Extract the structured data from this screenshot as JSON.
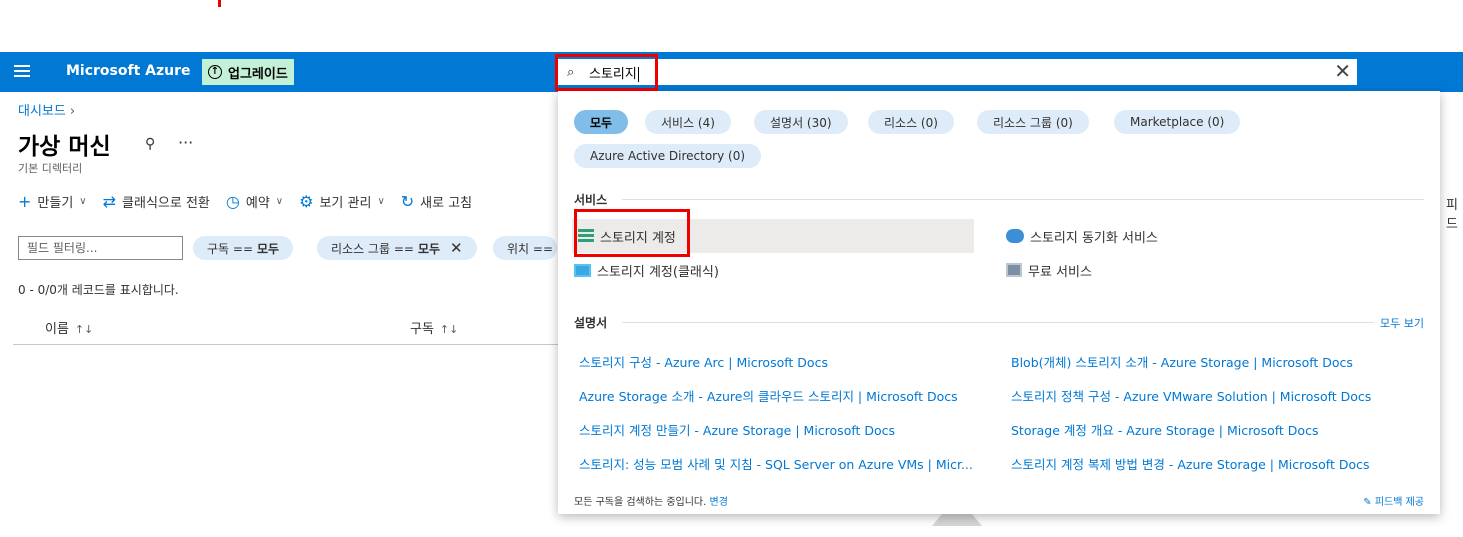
{
  "topbar": {
    "brand": "Microsoft Azure",
    "upgrade_label": "업그레이드",
    "search_value": "스토리지"
  },
  "page": {
    "breadcrumb": "대시보드",
    "title": "가상 머신",
    "subtitle": "기본 디렉터리",
    "commands": [
      {
        "icon": "plus-icon",
        "label": "만들기"
      },
      {
        "icon": "switch-icon",
        "label": "클래식으로 전환"
      },
      {
        "icon": "clock-icon",
        "label": "예약"
      },
      {
        "icon": "gear-icon",
        "label": "보기 관리"
      },
      {
        "icon": "refresh-icon",
        "label": "새로 고침"
      }
    ],
    "feedback_partial": "피드",
    "filter_placeholder": "필드 필터링...",
    "filter_pills": [
      {
        "key": "구독 ==",
        "value": "모두"
      },
      {
        "key": "리소스 그룹 ==",
        "value": "모두"
      },
      {
        "key": "위치 ==",
        "value": ""
      }
    ],
    "records": "0 - 0/0개 레코드를 표시합니다.",
    "columns": [
      "이름",
      "구독"
    ]
  },
  "dropdown": {
    "chips": [
      {
        "label": "모두",
        "active": true
      },
      {
        "label": "서비스  (4)"
      },
      {
        "label": "설명서  (30)"
      },
      {
        "label": "리소스  (0)"
      },
      {
        "label": "리소스 그룹  (0)"
      },
      {
        "label": "Marketplace  (0)"
      },
      {
        "label": "Azure Active Directory  (0)"
      }
    ],
    "services_title": "서비스",
    "services": [
      {
        "icon": "storage-account-icon",
        "label": "스토리지 계정"
      },
      {
        "icon": "storage-sync-icon",
        "label": "스토리지 동기화 서비스"
      },
      {
        "icon": "storage-classic-icon",
        "label": "스토리지 계정(클래식)"
      },
      {
        "icon": "free-services-icon",
        "label": "무료 서비스"
      }
    ],
    "docs_title": "설명서",
    "docs_more": "모두 보기",
    "docs": [
      "스토리지 구성 - Azure Arc | Microsoft Docs",
      "Blob(개체) 스토리지 소개 - Azure Storage | Microsoft Docs",
      "Azure Storage 소개 - Azure의 클라우드 스토리지 | Microsoft Docs",
      "스토리지 정책 구성 - Azure VMware Solution | Microsoft Docs",
      "스토리지 계정 만들기 - Azure Storage | Microsoft Docs",
      "Storage 계정 개요 - Azure Storage | Microsoft Docs",
      "스토리지: 성능 모범 사례 및 지침 - SQL Server on Azure VMs | Micr...",
      "스토리지 계정 복제 방법 변경 - Azure Storage | Microsoft Docs"
    ],
    "footer_text": "모든 구독을 검색하는 중입니다.",
    "footer_link": "변경",
    "footer_feedback": "피드백 제공"
  }
}
